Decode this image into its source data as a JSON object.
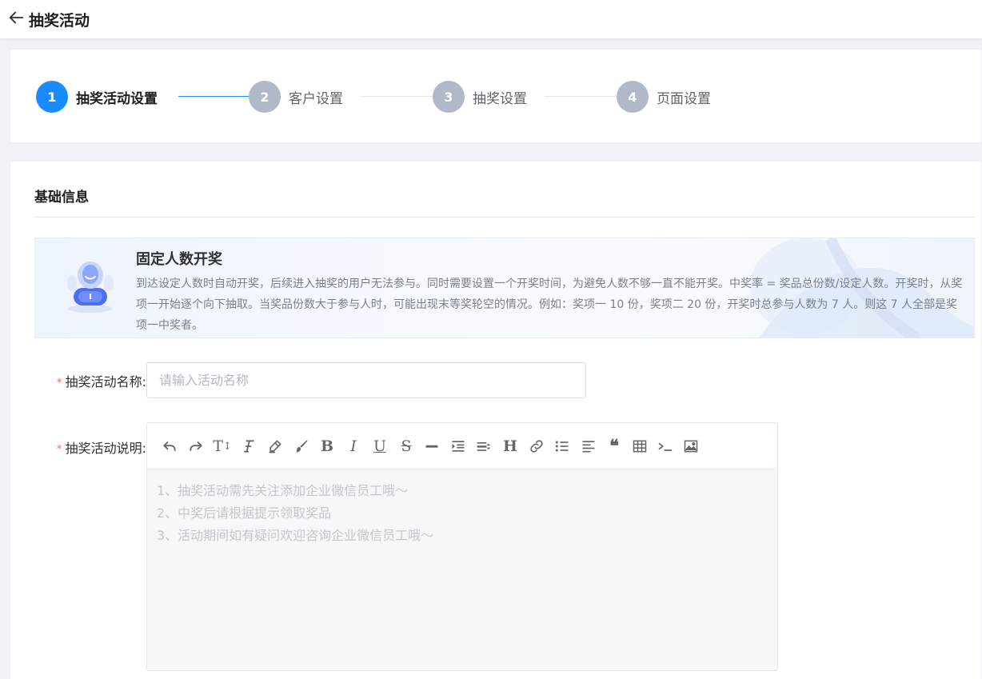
{
  "header": {
    "back_icon": "arrow-left-icon",
    "title": "抽奖活动"
  },
  "steps": [
    {
      "number": "1",
      "label": "抽奖活动设置",
      "active": true
    },
    {
      "number": "2",
      "label": "客户设置",
      "active": false
    },
    {
      "number": "3",
      "label": "抽奖设置",
      "active": false
    },
    {
      "number": "4",
      "label": "页面设置",
      "active": false
    }
  ],
  "section": {
    "title": "基础信息"
  },
  "tip": {
    "title": "固定人数开奖",
    "description": "到达设定人数时自动开奖，后续进入抽奖的用户无法参与。同时需要设置一个开奖时间，为避免人数不够一直不能开奖。中奖率 = 奖品总份数/设定人数。开奖时，从奖项一开始逐个向下抽取。当奖品份数大于参与人时，可能出现末等奖轮空的情况。例如：奖项一 10 份，奖项二 20 份，开奖时总参与人数为 7 人。则这 7 人全部是奖项一中奖者。"
  },
  "form": {
    "required_mark": "*",
    "name_label": "抽奖活动名称:",
    "name_placeholder": "请输入活动名称",
    "name_value": "",
    "desc_label": "抽奖活动说明:",
    "desc_placeholder_lines": [
      "1、抽奖活动需先关注添加企业微信员工哦～",
      "2、中奖后请根据提示领取奖品",
      "3、活动期间如有疑问欢迎咨询企业微信员工哦～"
    ]
  },
  "toolbar": {
    "buttons": [
      "undo-icon",
      "redo-icon",
      "text-size-icon",
      "font-family-icon",
      "highlighter-icon",
      "brush-icon",
      "bold-icon",
      "italic-icon",
      "underline-icon",
      "strikethrough-icon",
      "horizontal-rule-icon",
      "indent-icon",
      "line-height-icon",
      "heading-icon",
      "link-icon",
      "unordered-list-icon",
      "align-left-icon",
      "quote-icon",
      "table-icon",
      "code-icon",
      "image-icon"
    ],
    "text_glyphs": {
      "text_size": "T",
      "bold": "B",
      "italic": "I",
      "underline": "U",
      "strikethrough": "S",
      "heading": "H",
      "quote": "❝"
    }
  },
  "colors": {
    "primary": "#1a8cff",
    "inactive_step": "#b0b8c9",
    "required": "#f56c6c",
    "background": "#f0f2f5"
  }
}
